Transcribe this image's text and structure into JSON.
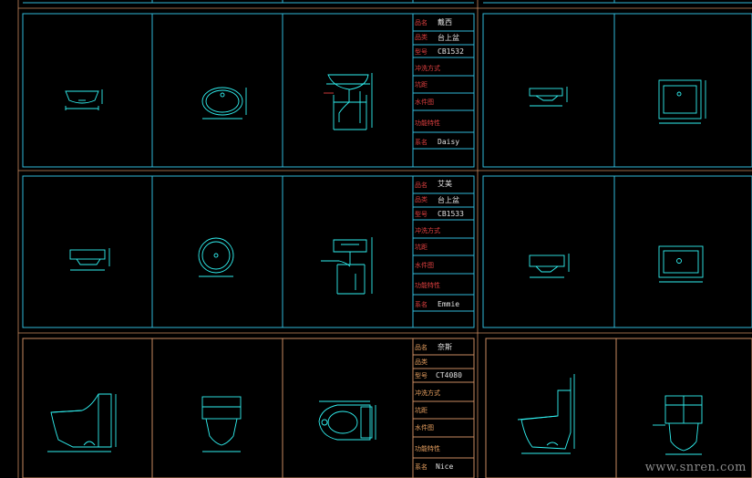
{
  "colors": {
    "background": "#000000",
    "frame_cyan": "#2fb8d8",
    "frame_orange": "#c88a60",
    "drawing_cyan": "#30f0f0",
    "label_red": "#e04040",
    "label_orange": "#e8a060",
    "text_white": "#e0e0e0"
  },
  "sheets": [
    {
      "field_labels": [
        "品名",
        "品类",
        "型号",
        "冲洗方式",
        "坑距",
        "水件图",
        "功能特性",
        "系名"
      ],
      "name": "戴西",
      "category": "台上盆",
      "model": "CB1532",
      "series": "Daisy"
    },
    {
      "field_labels": [
        "品名",
        "品类",
        "型号",
        "冲洗方式",
        "坑距",
        "水件图",
        "功能特性",
        "系名"
      ],
      "name": "艾美",
      "category": "台上盆",
      "model": "CB1533",
      "series": "Emmie"
    },
    {
      "field_labels": [
        "品名",
        "品类",
        "型号",
        "冲洗方式",
        "坑距",
        "水件图",
        "功能特性",
        "系名"
      ],
      "name": "奈斯",
      "category": "",
      "model": "CT4080",
      "series": "Nice"
    }
  ],
  "watermark": "www.snren.com"
}
